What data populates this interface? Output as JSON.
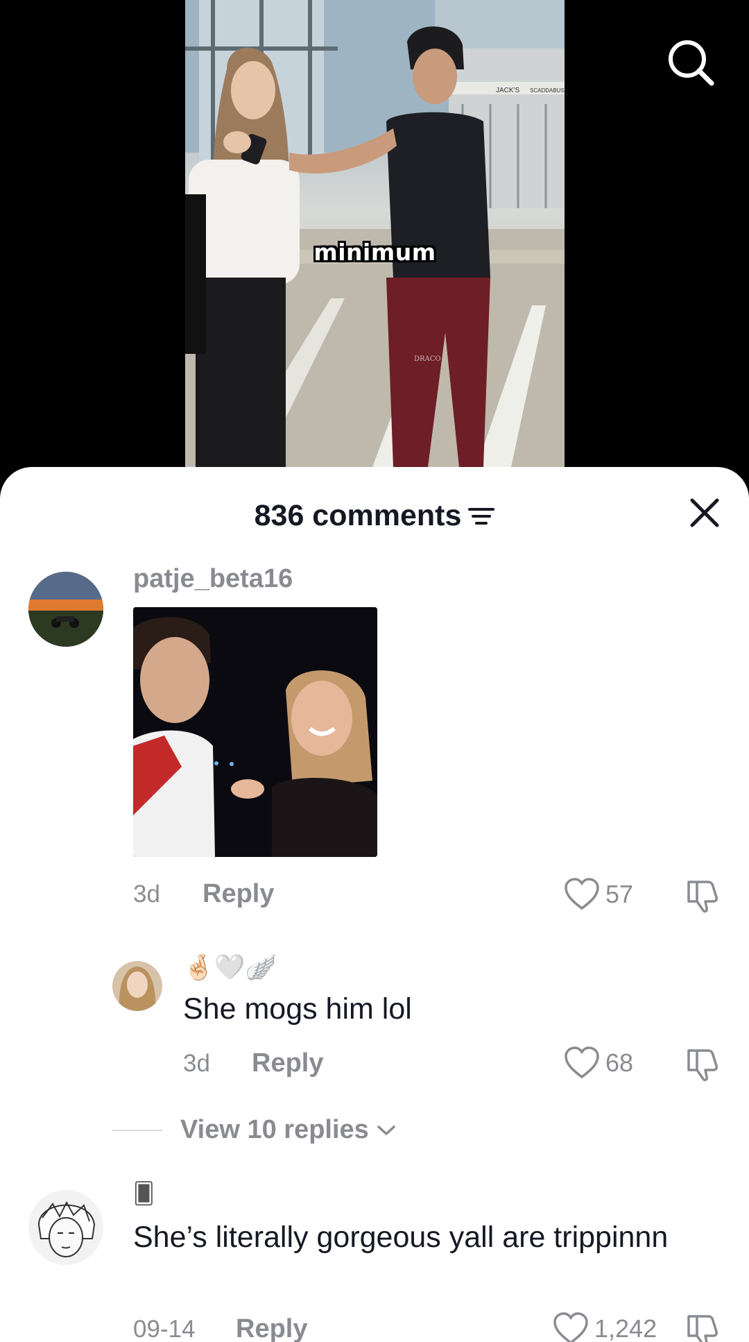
{
  "video": {
    "caption": "minimum",
    "storefront_sign_1": "JACK'S",
    "storefront_sign_2": "SCADDABUSH",
    "pants_brand": "DRACO"
  },
  "header": {
    "comments_count": "836 comments"
  },
  "comments": [
    {
      "username": "patje_beta16",
      "time": "3d",
      "reply_label": "Reply",
      "likes": "57"
    },
    {
      "username": "🤞🏻🤍🪽",
      "text": "She mogs him lol",
      "time": "3d",
      "reply_label": "Reply",
      "likes": "68"
    },
    {
      "username": "🂠",
      "text": "She’s literally gorgeous yall are trippinnn",
      "time": "09-14",
      "reply_label": "Reply",
      "likes": "1,242"
    }
  ],
  "view_replies": "View 10 replies",
  "icons": {
    "search": "search-icon",
    "filter": "filter-icon",
    "close": "close-icon",
    "like": "heart-icon",
    "dislike": "thumbs-down-icon",
    "chevron": "chevron-down-icon"
  },
  "colors": {
    "text_primary": "#161823",
    "text_secondary": "#8a8b91",
    "sheet_bg": "#ffffff"
  }
}
